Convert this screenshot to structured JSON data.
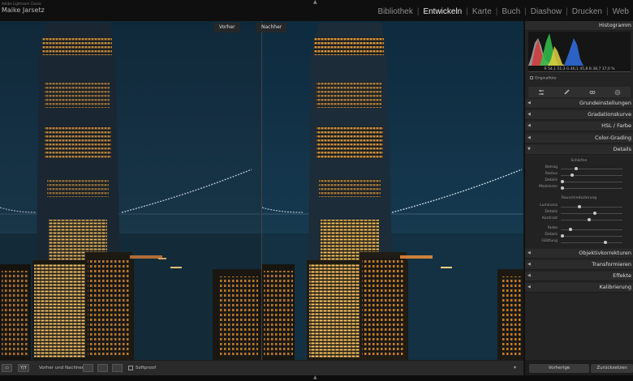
{
  "app": {
    "name": "Adobe Lightroom Classic",
    "user": "Maike Jarsetz"
  },
  "top_arrow_icon": "triangle-up-icon",
  "modules": [
    {
      "label": "Bibliothek",
      "active": false
    },
    {
      "label": "Entwickeln",
      "active": true
    },
    {
      "label": "Karte",
      "active": false
    },
    {
      "label": "Buch",
      "active": false
    },
    {
      "label": "Diashow",
      "active": false
    },
    {
      "label": "Drucken",
      "active": false
    },
    {
      "label": "Web",
      "active": false
    }
  ],
  "view": {
    "before_label": "Vorher",
    "after_label": "Nachher"
  },
  "panel": {
    "histogram_title": "Histogramm",
    "histogram_values": "R  54,1  51,3  G  46,1  45,8  B  38,7  37,0  %",
    "original_photo": "Originalfoto",
    "sections": {
      "grundeinstellungen": "Grundeinstellungen",
      "gradation": "Gradationskurve",
      "hsl": "HSL / Farbe",
      "color_grading": "Color-Grading",
      "details": "Details",
      "objektiv": "Objektivkorrekturen",
      "transformieren": "Transformieren",
      "effekte": "Effekte",
      "kalibrierung": "Kalibrierung"
    },
    "detail": {
      "schaerfen_title": "Schärfen",
      "sharpen": [
        {
          "label": "Betrag",
          "value": 0.25
        },
        {
          "label": "Radius",
          "value": 0.18
        },
        {
          "label": "Details",
          "value": 0.02
        },
        {
          "label": "Maskieren",
          "value": 0.02
        }
      ],
      "rausch_title": "Rauschreduzierung",
      "noise": [
        {
          "label": "Luminanz",
          "value": 0.3
        },
        {
          "label": "Details",
          "value": 0.55
        },
        {
          "label": "Kontrast",
          "value": 0.46
        },
        {
          "label": "Farbe",
          "value": 0.16
        },
        {
          "label": "Details",
          "value": 0.02
        },
        {
          "label": "Glättung",
          "value": 0.72
        }
      ]
    },
    "btn_previous": "Vorherige",
    "btn_reset": "Zurücksetzen"
  },
  "toolbar": {
    "loupe": "▭",
    "compare_mode": "Y|Y",
    "label": "Vorher und Nachher:",
    "softproof": "Softproof"
  }
}
